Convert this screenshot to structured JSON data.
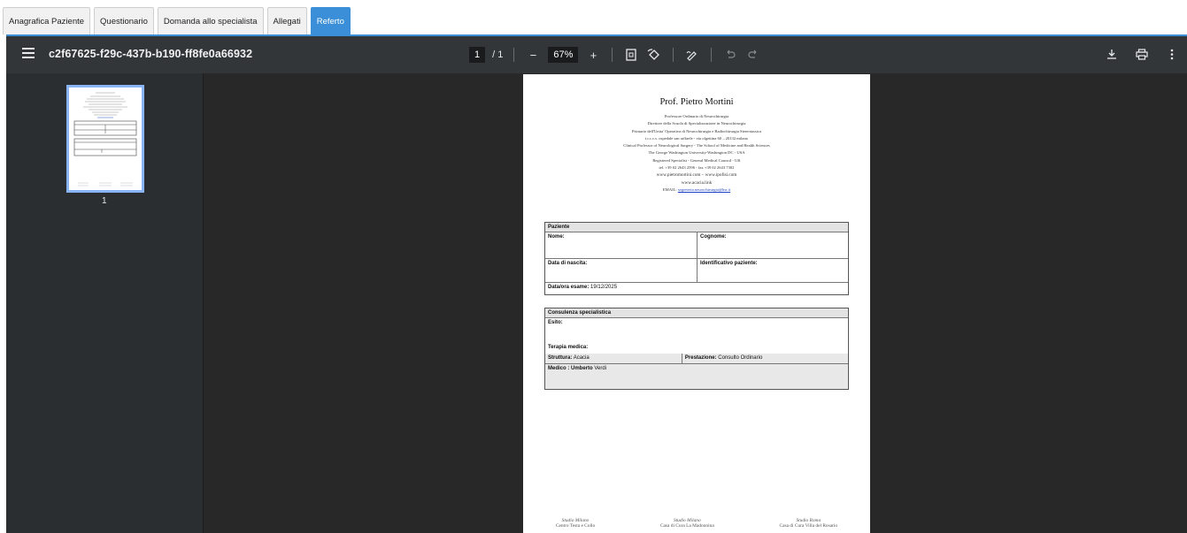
{
  "tabs": [
    {
      "label": "Anagrafica Paziente",
      "active": false
    },
    {
      "label": "Questionario",
      "active": false
    },
    {
      "label": "Domanda allo specialista",
      "active": false
    },
    {
      "label": "Allegati",
      "active": false
    },
    {
      "label": "Referto",
      "active": true
    }
  ],
  "viewer": {
    "title": "c2f67625-f29c-437b-b190-ff8fe0a66932",
    "page_current": "1",
    "page_total": "/ 1",
    "zoom": "67%",
    "zoom_out": "−",
    "zoom_in": "+",
    "thumbnail_page": "1"
  },
  "icons": {
    "menu": "menu-icon",
    "fit": "fit-page-icon",
    "rotate": "rotate-icon",
    "annotate": "annotate-icon",
    "undo": "undo-icon",
    "redo": "redo-icon",
    "download": "download-icon",
    "print": "print-icon",
    "more": "more-icon"
  },
  "doc": {
    "name": "Prof. Pietro Mortini",
    "lines": [
      "Professore Ordinario di Neurochirurgia",
      "Direttore della Scuola di Specializzazione in Neurochirurgia",
      "Primario dell'Unita' Operativa di Neurochirurgia e Radiochirurgia Stereotassica",
      "i.r.c.c.s. ospedale san raffaele - via olgettina 60 – 20132 milano",
      "Clinical Professor of Neurological Surgery - The School of Medicine and Health Sciences",
      "The George Washington University-Washington DC - USA",
      "Registered Specialist - General Medical Council - UK",
      "tel. +39 02 2643 2596 - fax +39 02 2643 7302",
      "www.pietromortini.com – www.ipofisi.com",
      "www.acacia.link"
    ],
    "email_label": "EMAIL:",
    "email": "segreteria.neurochirurgia@hsr.it",
    "paziente": {
      "title": "Paziente",
      "nome_label": "Nome:",
      "cognome_label": "Cognome:",
      "nascita_label": "Data di nascita:",
      "id_label": "Identificativo paziente:",
      "esame_label": "Data/ora esame:",
      "esame_value": "19/12/2025"
    },
    "consulenza": {
      "title": "Consulenza specialistica",
      "esito_label": "Esito:",
      "terapia_label": "Terapia medica:",
      "struttura_label": "Struttura:",
      "struttura_value": "Acacia",
      "prestazione_label": "Prestazione:",
      "prestazione_value": "Consulto Ordinario",
      "medico_label": "Medico : Umberto",
      "medico_value": "Verdi"
    },
    "footer": [
      {
        "studio": "Studio Milano",
        "place": "Centro Testa e Collo"
      },
      {
        "studio": "Studio Milano",
        "place": "Casa di Cura La Madonnina"
      },
      {
        "studio": "Studio Roma",
        "place": "Casa di Cura Villa del Rosario"
      }
    ]
  }
}
